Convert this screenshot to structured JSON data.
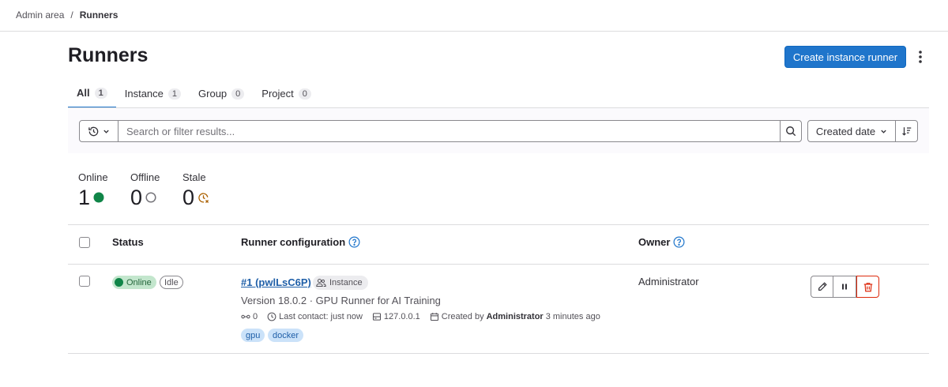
{
  "breadcrumb": {
    "parent": "Admin area",
    "separator": "/",
    "current": "Runners"
  },
  "header": {
    "title": "Runners",
    "create_button": "Create instance runner"
  },
  "tabs": [
    {
      "label": "All",
      "count": "1"
    },
    {
      "label": "Instance",
      "count": "1"
    },
    {
      "label": "Group",
      "count": "0"
    },
    {
      "label": "Project",
      "count": "0"
    }
  ],
  "filter": {
    "placeholder": "Search or filter results...",
    "sort_label": "Created date"
  },
  "stats": [
    {
      "label": "Online",
      "value": "1"
    },
    {
      "label": "Offline",
      "value": "0"
    },
    {
      "label": "Stale",
      "value": "0"
    }
  ],
  "table": {
    "headers": {
      "status": "Status",
      "configuration": "Runner configuration",
      "owner": "Owner"
    },
    "rows": [
      {
        "status": "Online",
        "state": "Idle",
        "runner_id": "#1 (pwlLsC6P)",
        "type": "Instance",
        "description": "Version 18.0.2 · GPU Runner for AI Training",
        "jobs": "0",
        "last_contact": "Last contact: just now",
        "ip": "127.0.0.1",
        "created_prefix": "Created by",
        "created_by": "Administrator",
        "created_ago": "3 minutes ago",
        "tags": [
          "gpu",
          "docker"
        ],
        "owner": "Administrator"
      }
    ]
  },
  "colors": {
    "primary": "#1f75cb",
    "online": "#108548",
    "danger": "#dd2b0e",
    "stale": "#ab6100"
  }
}
